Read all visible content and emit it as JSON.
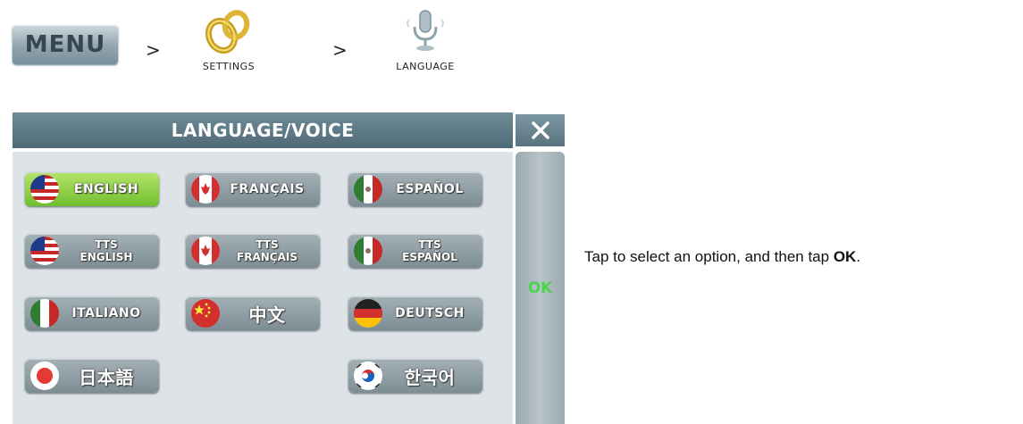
{
  "breadcrumb": {
    "menu_label": "MENU",
    "sep1": ">",
    "settings_label": "SETTINGS",
    "sep2": ">",
    "language_label": "LANGUAGE"
  },
  "dialog": {
    "title": "LANGUAGE/VOICE",
    "close_symbol": "✕",
    "ok_label": "OK"
  },
  "languages": [
    {
      "label": "ENGLISH"
    },
    {
      "label": "FRANÇAIS"
    },
    {
      "label": "ESPAÑOL"
    },
    {
      "tts": "TTS",
      "label": "ENGLISH"
    },
    {
      "tts": "TTS",
      "label": "FRANÇAIS"
    },
    {
      "tts": "TTS",
      "label": "ESPAÑOL"
    },
    {
      "label": "ITALIANO"
    },
    {
      "label": "中文"
    },
    {
      "label": "DEUTSCH"
    },
    {
      "label": "日本語"
    },
    {
      "label": "한국어"
    }
  ],
  "instruction": {
    "text": "Tap to select an option, and then tap ",
    "emphasis": "OK",
    "end": "."
  }
}
